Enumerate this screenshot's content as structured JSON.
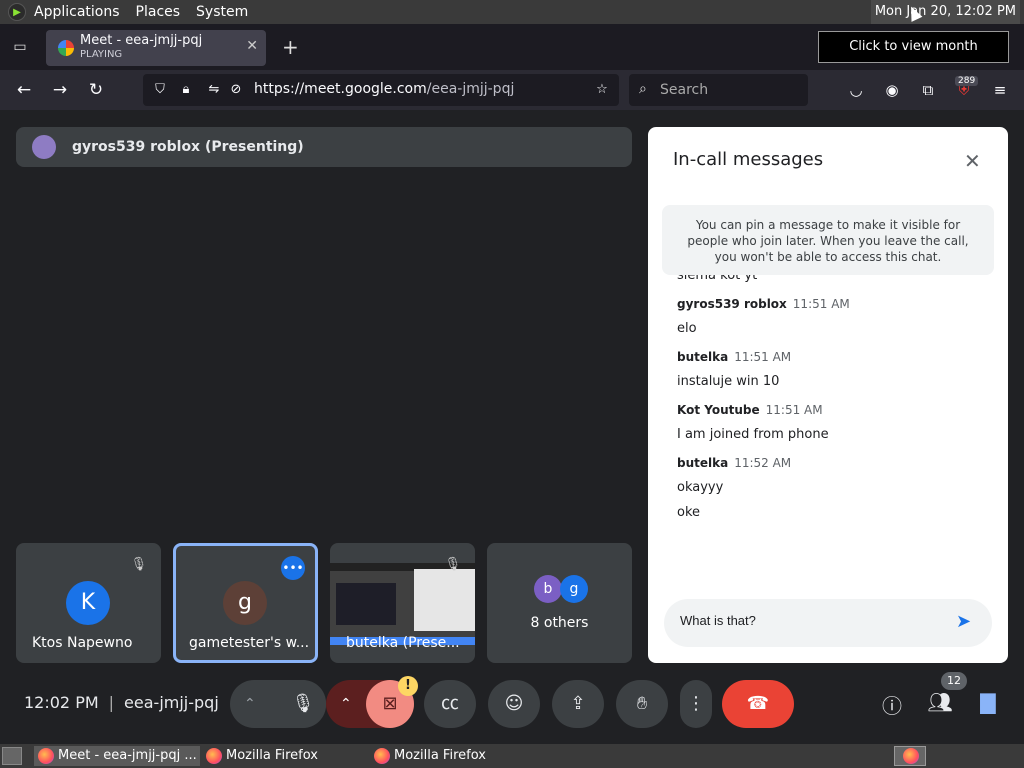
{
  "panel": {
    "applications": "Applications",
    "places": "Places",
    "system": "System",
    "clock": "Mon Jan 20, 12:02 PM"
  },
  "browser": {
    "tab_title": "Meet - eea-jmjj-pqj",
    "tab_subtitle": "PLAYING",
    "tooltip": "Click to view month calendar",
    "url_domain": "https://meet.google.com",
    "url_path": "/eea-jmjj-pqj",
    "search_placeholder": "Search",
    "extension_badge": "289"
  },
  "meet": {
    "presenting": "gyros539 roblox (Presenting)",
    "tiles": [
      {
        "initial": "K",
        "name": "Ktos Napewno",
        "color": "#1a73e8"
      },
      {
        "initial": "g",
        "name": "gametester's w...",
        "color": "#5d4037"
      },
      {
        "name": "butelka (Prese..."
      },
      {
        "others_label": "8 others",
        "avatars": [
          "b",
          "g"
        ]
      }
    ],
    "meeting_time": "12:02 PM",
    "meeting_code": "eea-jmjj-pqj",
    "people_count": "12",
    "warning": "!"
  },
  "chat": {
    "title": "In-call messages",
    "info": "You can pin a message to make it visible for people who join later. When you leave the call, you won't be able to access this chat.",
    "partial_message": "siema kot yt",
    "messages": [
      {
        "author": "gyros539 roblox",
        "time": "11:51 AM",
        "lines": [
          "elo"
        ]
      },
      {
        "author": "butelka",
        "time": "11:51 AM",
        "lines": [
          "instaluje win 10"
        ]
      },
      {
        "author": "Kot Youtube",
        "time": "11:51 AM",
        "lines": [
          "I am joined from phone"
        ]
      },
      {
        "author": "butelka",
        "time": "11:52 AM",
        "lines": [
          "okayyy",
          "oke"
        ]
      }
    ],
    "input_value": "What is that?"
  },
  "taskbar": {
    "items": [
      "Meet - eea-jmjj-pqj ...",
      "Mozilla Firefox",
      "Mozilla Firefox"
    ]
  },
  "colors": {
    "meet_bg": "#202124",
    "end_call": "#ea4335",
    "accent": "#1a73e8"
  }
}
